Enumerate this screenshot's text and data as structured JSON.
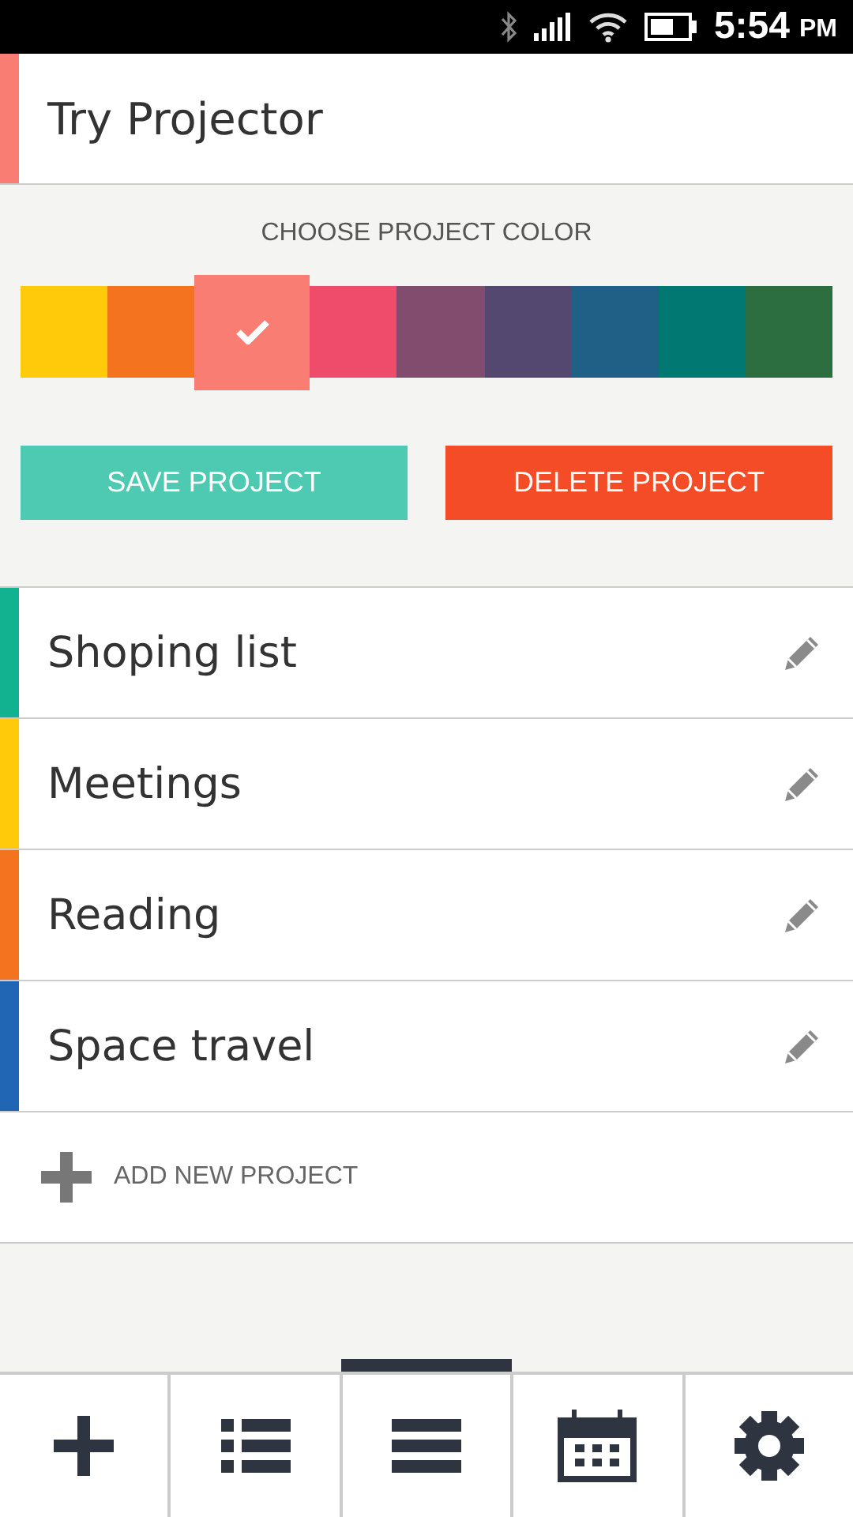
{
  "status_bar": {
    "time": "5:54",
    "ampm": "PM"
  },
  "editor": {
    "name": "Try Projector",
    "color_label": "CHOOSE PROJECT COLOR",
    "swatches": [
      {
        "color": "#ffca0a",
        "selected": false
      },
      {
        "color": "#f3731e",
        "selected": false
      },
      {
        "color": "#fa7d74",
        "selected": true
      },
      {
        "color": "#ef4c6b",
        "selected": false
      },
      {
        "color": "#824c6e",
        "selected": false
      },
      {
        "color": "#554870",
        "selected": false
      },
      {
        "color": "#206087",
        "selected": false
      },
      {
        "color": "#017871",
        "selected": false
      },
      {
        "color": "#2c6e3f",
        "selected": false
      }
    ],
    "save_label": "SAVE PROJECT",
    "delete_label": "DELETE PROJECT"
  },
  "projects": [
    {
      "name": "Shoping list",
      "color": "#12b290"
    },
    {
      "name": "Meetings",
      "color": "#ffca0a"
    },
    {
      "name": "Reading",
      "color": "#f3731e"
    },
    {
      "name": "Space travel",
      "color": "#2166b4"
    }
  ],
  "add_label": "ADD NEW PROJECT",
  "nav": [
    {
      "kind": "add",
      "selected": false
    },
    {
      "kind": "list",
      "selected": false
    },
    {
      "kind": "menu",
      "selected": true
    },
    {
      "kind": "calendar",
      "selected": false
    },
    {
      "kind": "settings",
      "selected": false
    }
  ]
}
